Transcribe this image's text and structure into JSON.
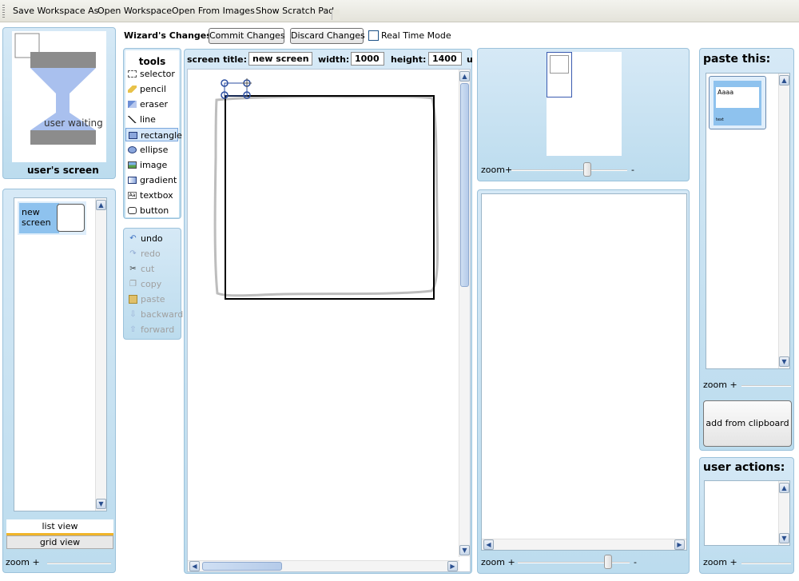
{
  "menu": {
    "items": [
      "Save Workspace As",
      "Open Workspace",
      "Open From Images",
      "Show Scratch Pad"
    ]
  },
  "users_screen": {
    "title": "user's screen",
    "status": "user waiting"
  },
  "screen_list": {
    "items": [
      {
        "label": "new screen"
      }
    ],
    "list_view_label": "list view",
    "grid_view_label": "grid view",
    "zoom_label": "zoom +"
  },
  "wizard": {
    "label": "Wizard's Changes:",
    "commit_label": "Commit Changes",
    "discard_label": "Discard Changes",
    "realtime_label": "Real Time Mode",
    "realtime_checked": false
  },
  "tools": {
    "title": "tools",
    "items": [
      {
        "label": "selector",
        "icon": "selector-icon",
        "selected": false
      },
      {
        "label": "pencil",
        "icon": "pencil-icon",
        "selected": false
      },
      {
        "label": "eraser",
        "icon": "eraser-icon",
        "selected": false
      },
      {
        "label": "line",
        "icon": "line-icon",
        "selected": false
      },
      {
        "label": "rectangle",
        "icon": "rectangle-icon",
        "selected": true
      },
      {
        "label": "ellipse",
        "icon": "ellipse-icon",
        "selected": false
      },
      {
        "label": "image",
        "icon": "image-icon",
        "selected": false
      },
      {
        "label": "gradient",
        "icon": "gradient-icon",
        "selected": false
      },
      {
        "label": "textbox",
        "icon": "textbox-icon",
        "selected": false
      },
      {
        "label": "button",
        "icon": "button-icon",
        "selected": false
      }
    ]
  },
  "edit": {
    "items": [
      {
        "label": "undo",
        "icon": "undo-icon",
        "enabled": true
      },
      {
        "label": "redo",
        "icon": "redo-icon",
        "enabled": false
      },
      {
        "label": "cut",
        "icon": "cut-icon",
        "enabled": false
      },
      {
        "label": "copy",
        "icon": "copy-icon",
        "enabled": false
      },
      {
        "label": "paste",
        "icon": "paste-icon",
        "enabled": false
      },
      {
        "label": "backward",
        "icon": "backward-icon",
        "enabled": false
      },
      {
        "label": "forward",
        "icon": "forward-icon",
        "enabled": false
      }
    ]
  },
  "editor": {
    "screen_title_label": "screen title:",
    "screen_title_value": "new screen",
    "width_label": "width:",
    "width_value": "1000",
    "height_label": "height:",
    "height_value": "1400",
    "cut_off_label": "u"
  },
  "overview": {
    "zoom_label": "zoom+",
    "zoom_end": "-"
  },
  "preview": {
    "zoom_label": "zoom +",
    "zoom_end": "-"
  },
  "paste": {
    "title": "paste this:",
    "thumb_text": "Aaaa",
    "thumb_small": "text",
    "zoom_label": "zoom +",
    "add_clipboard_label": "add from clipboard"
  },
  "user_actions": {
    "title": "user actions:",
    "zoom_label": "zoom +"
  }
}
